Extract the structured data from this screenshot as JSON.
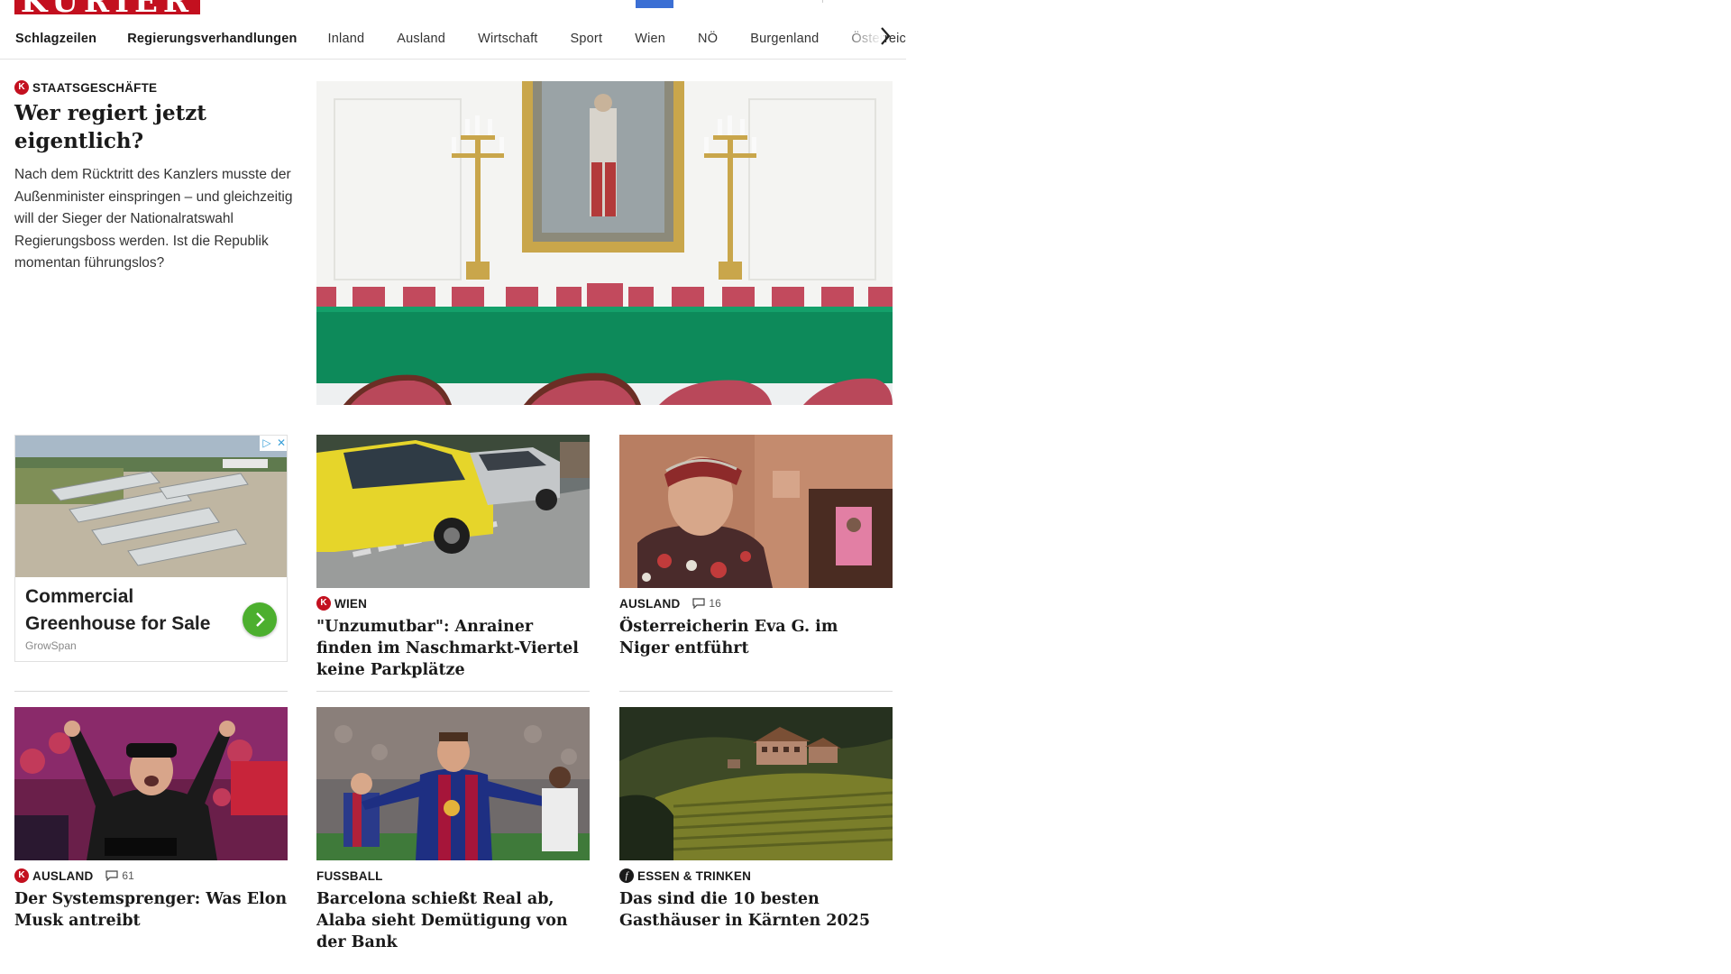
{
  "brand": {
    "logo_text": "KURIER",
    "color": "#c3101f"
  },
  "nav": {
    "items": [
      "Schlagzeilen",
      "Regierungsverhandlungen",
      "Inland",
      "Ausland",
      "Wirtschaft",
      "Sport",
      "Wien",
      "NÖ",
      "Burgenland",
      "Österreich"
    ],
    "next_icon": "chevron-right-icon"
  },
  "lead": {
    "badge": "K",
    "kicker": "Staatsgeschäfte",
    "title": "Wer regiert jetzt eigentlich?",
    "teaser": "Nach dem Rücktritt des Kanzlers musste der Außenminister einspringen – und gleichzeitig will der Sieger der Nationalratswahl Regierungsboss werden. Ist die Republik momentan führungslos?"
  },
  "ad": {
    "title": "Commercial Greenhouse for Sale",
    "source": "GrowSpan",
    "choices_info": "▷",
    "choices_close": "✕"
  },
  "cards": [
    {
      "badge": "K",
      "section": "Wien",
      "comments": "",
      "title": "\"Unzumutbar\": Anrainer finden im Naschmarkt-Viertel keine Parkplätze"
    },
    {
      "badge": "",
      "section": "Ausland",
      "comments": "16",
      "title": "Österreicherin Eva G. im Niger entführt"
    },
    {
      "badge": "K",
      "section": "Ausland",
      "comments": "61",
      "title": "Der Systemsprenger: Was Elon Musk antreibt"
    },
    {
      "badge": "",
      "section": "Fussball",
      "comments": "",
      "title": "Barcelona schießt Real ab, Alaba sieht Demütigung von der Bank"
    },
    {
      "badge": "f",
      "section": "Essen & Trinken",
      "comments": "",
      "title": "Das sind die 10 besten Gasthäuser in Kärnten 2025"
    }
  ]
}
